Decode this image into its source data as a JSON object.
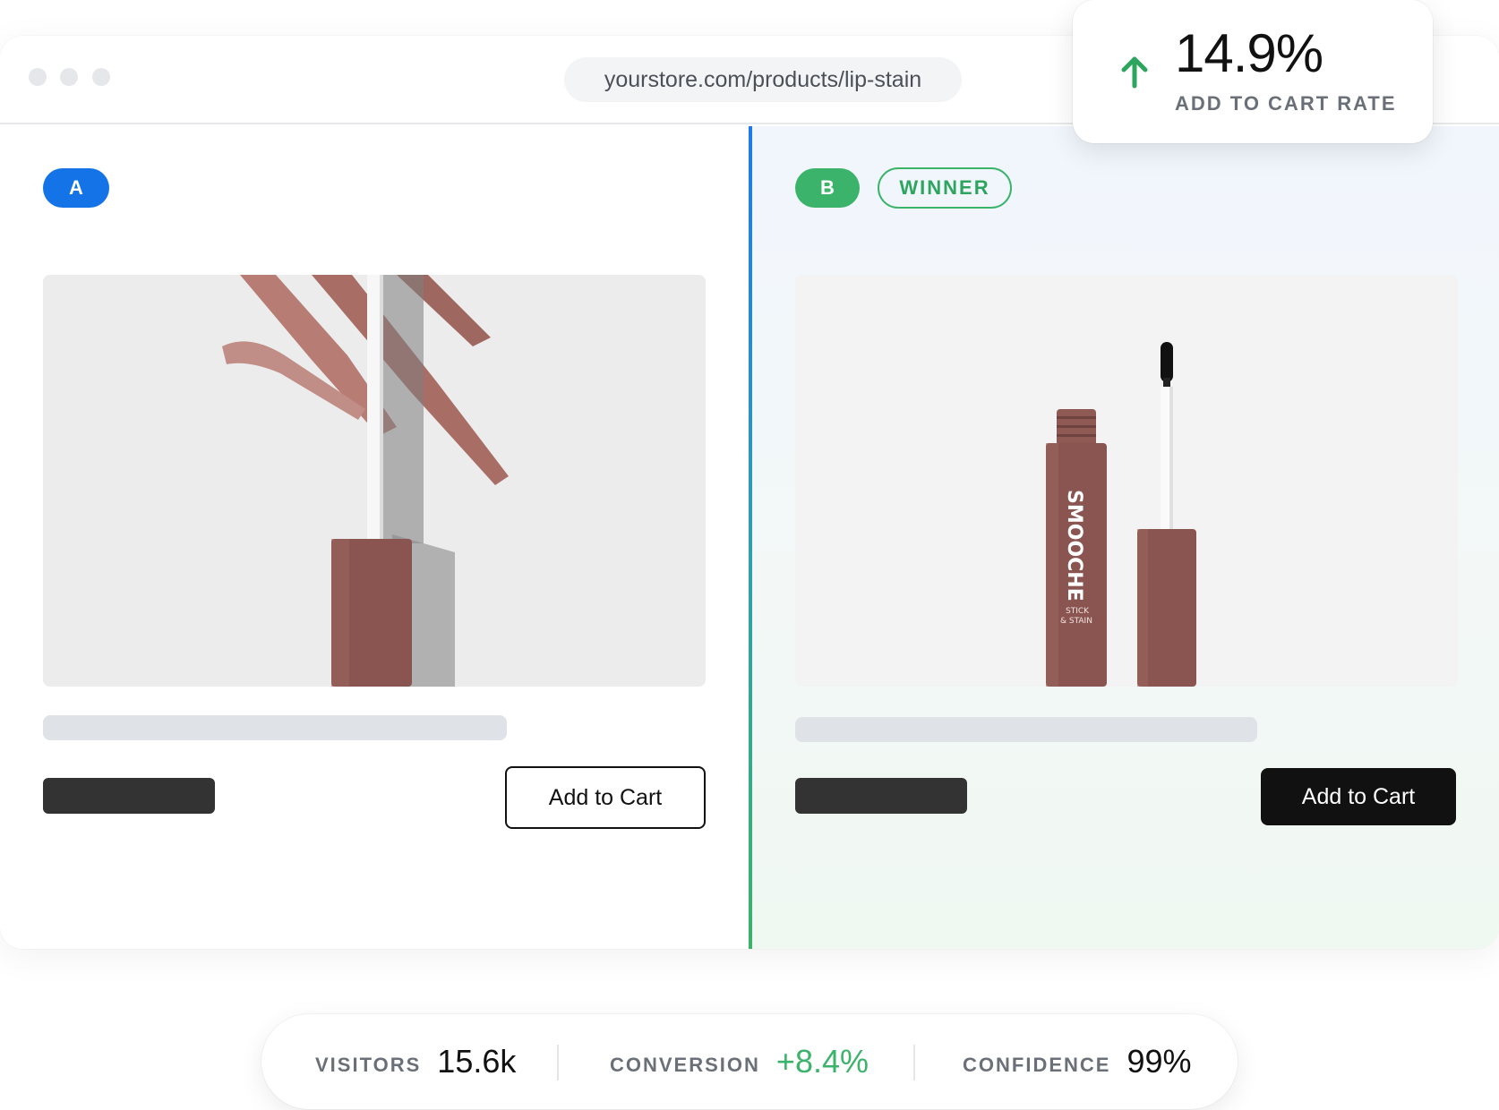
{
  "browser": {
    "url": "yourstore.com/products/lip-stain"
  },
  "variant_a": {
    "badge": "A",
    "add_to_cart": "Add to Cart"
  },
  "variant_b": {
    "badge": "B",
    "winner_label": "WINNER",
    "add_to_cart": "Add to Cart",
    "brand_text": "SMOOCHE",
    "sub_text_1": "STICK",
    "sub_text_2": "& STAIN"
  },
  "highlight": {
    "value": "14.9%",
    "label": "ADD TO CART RATE",
    "trend_icon": "arrow-up-icon"
  },
  "metrics": [
    {
      "label": "VISITORS",
      "value": "15.6k"
    },
    {
      "label": "CONVERSION",
      "value": "+8.4%"
    },
    {
      "label": "CONFIDENCE",
      "value": "99%"
    }
  ],
  "colors": {
    "accent_blue": "#1473e6",
    "accent_green": "#3bb36a",
    "product_brown": "#8a5550"
  }
}
